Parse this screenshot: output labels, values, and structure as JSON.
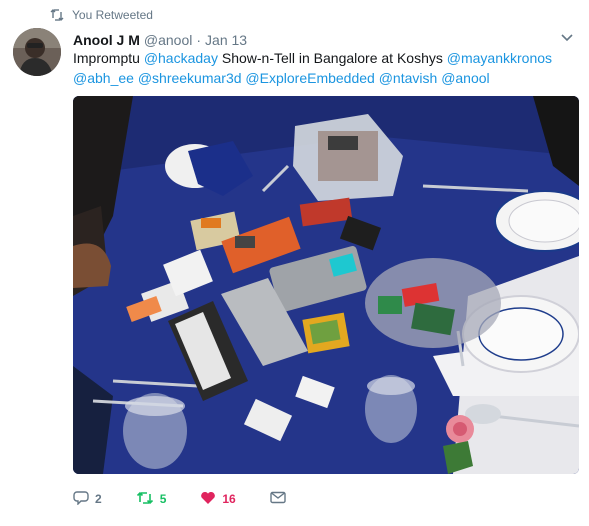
{
  "retweet_context": {
    "label": "You Retweeted",
    "icon": "retweet-icon"
  },
  "tweet": {
    "author_name": "Anool J M",
    "author_handle": "@anool",
    "separator": "·",
    "timestamp": "Jan 13",
    "text_parts": [
      {
        "t": "Impromptu ",
        "link": false
      },
      {
        "t": "@hackaday",
        "link": true
      },
      {
        "t": " Show-n-Tell in Bangalore at Koshys ",
        "link": false
      },
      {
        "t": "@mayankkronos",
        "link": true
      },
      {
        "t": " ",
        "link": false
      },
      {
        "t": "@abh_ee",
        "link": true
      },
      {
        "t": " ",
        "link": false
      },
      {
        "t": "@shreekumar3d",
        "link": true
      },
      {
        "t": " ",
        "link": false
      },
      {
        "t": "@ExploreEmbedded",
        "link": true
      },
      {
        "t": " ",
        "link": false
      },
      {
        "t": "@ntavish",
        "link": true
      },
      {
        "t": " ",
        "link": false
      },
      {
        "t": "@anool",
        "link": true
      }
    ]
  },
  "actions": {
    "reply_count": "2",
    "retweet_count": "5",
    "like_count": "16"
  },
  "colors": {
    "link": "#1b95e0",
    "muted": "#657786",
    "retweet_active": "#17bf63",
    "like_active": "#e0245e"
  }
}
